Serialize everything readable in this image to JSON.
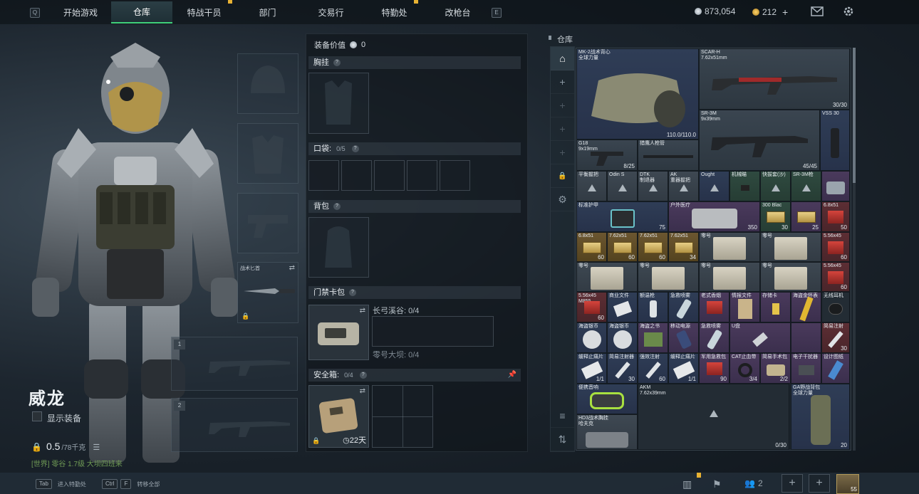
{
  "topbar": {
    "left_key": "Q",
    "right_key": "E",
    "tabs": [
      {
        "label": "开始游戏"
      },
      {
        "label": "仓库"
      },
      {
        "label": "特战干员"
      },
      {
        "label": "部门"
      },
      {
        "label": "交易行"
      },
      {
        "label": "特勤处"
      },
      {
        "label": "改枪台"
      }
    ],
    "silver": "873,054",
    "gold": "212",
    "add": "+",
    "mail_icon": "mail-icon",
    "settings_icon": "gear-icon"
  },
  "character": {
    "name": "威龙",
    "show_gear_label": "显示装备",
    "weight_value": "0.5",
    "weight_unit": "/78千克",
    "chat_line": "[世界] 零谷 1.7级 大坝四班来",
    "melee_label": "战术匕首"
  },
  "slots": {
    "primary_num": "1",
    "secondary_num": "2"
  },
  "gear": {
    "value_label": "装备价值",
    "value": "0",
    "chest_rig": "胸挂",
    "pockets": "口袋:",
    "pockets_count": "0/5",
    "backpack": "背包",
    "keycard": "门禁卡包",
    "key_lines": [
      "长弓溪谷: 0/4",
      "零号大坝: 0/4"
    ],
    "safebox": "安全箱:",
    "safebox_count": "0/4",
    "safebox_days": "22天"
  },
  "warehouse": {
    "title": "仓库",
    "items": [
      {
        "label": "MK-2战术背心\n全球力量",
        "count": "110.0/110.0"
      },
      {
        "label": "SCAR-H\n7.62x51mm",
        "count": "30/30"
      },
      {
        "label": "SR-3M\n9x39mm",
        "count": "45/45"
      },
      {
        "label": "VSS 30",
        "count": ""
      },
      {
        "label": "G18\n9x19mm",
        "count": "8/25"
      },
      {
        "label": "猎鹰人枪管",
        "count": ""
      },
      {
        "label": "平衡握把",
        "count": ""
      },
      {
        "label": "Odin S",
        "count": ""
      },
      {
        "label": "DTK\n制退器",
        "count": ""
      },
      {
        "label": "AK\n重器握把",
        "count": ""
      },
      {
        "label": "Ought",
        "count": ""
      },
      {
        "label": "机械瞄",
        "count": ""
      },
      {
        "label": "快拔套(沙)",
        "count": ""
      },
      {
        "label": "SR-3M枪",
        "count": ""
      },
      {
        "label": "标准护甲",
        "count": "75"
      },
      {
        "label": "户外医疗",
        "count": "350"
      },
      {
        "label": "300 Blac",
        "count": "30"
      },
      {
        "label": "",
        "count": "25"
      },
      {
        "label": "6.8x51",
        "count": "50"
      },
      {
        "label": "6.8x51",
        "count": "60"
      },
      {
        "label": "7.62x51",
        "count": "60"
      },
      {
        "label": "7.62x51",
        "count": "60"
      },
      {
        "label": "7.62x51",
        "count": "34"
      },
      {
        "label": "零号",
        "count": ""
      },
      {
        "label": "零号",
        "count": ""
      },
      {
        "label": "5.56x45",
        "count": "60"
      },
      {
        "label": "零号",
        "count": ""
      },
      {
        "label": "零号",
        "count": ""
      },
      {
        "label": "零号",
        "count": ""
      },
      {
        "label": "零号",
        "count": ""
      },
      {
        "label": "5.56x45",
        "count": "60"
      },
      {
        "label": "5.56x45\nM855",
        "count": "60"
      },
      {
        "label": "商业文件",
        "count": ""
      },
      {
        "label": "额温枪",
        "count": ""
      },
      {
        "label": "急救喷雾",
        "count": ""
      },
      {
        "label": "老式香烟",
        "count": ""
      },
      {
        "label": "情报文件",
        "count": ""
      },
      {
        "label": "存储卡",
        "count": ""
      },
      {
        "label": "海盗金怀表",
        "count": ""
      },
      {
        "label": "无线耳机",
        "count": ""
      },
      {
        "label": "海盗银币",
        "count": ""
      },
      {
        "label": "海盗银币",
        "count": ""
      },
      {
        "label": "海盗之书",
        "count": ""
      },
      {
        "label": "移动电源",
        "count": ""
      },
      {
        "label": "急救喷雾",
        "count": ""
      },
      {
        "label": "U盘",
        "count": ""
      },
      {
        "label": "",
        "count": ""
      },
      {
        "label": "简易注射",
        "count": "30"
      },
      {
        "label": "缓释止痛片",
        "count": "1/1"
      },
      {
        "label": "简易注射器",
        "count": "30"
      },
      {
        "label": "强效注射",
        "count": "60"
      },
      {
        "label": "缓释止痛片",
        "count": "1/1"
      },
      {
        "label": "军用急救包",
        "count": "90"
      },
      {
        "label": "CAT止血带",
        "count": "3/4"
      },
      {
        "label": "简易手术包",
        "count": "2/2"
      },
      {
        "label": "电子干扰器",
        "count": ""
      },
      {
        "label": "设计图纸",
        "count": ""
      },
      {
        "label": "便携音响",
        "count": ""
      },
      {
        "label": "AKM\n7.62x39mm",
        "count": "0/30"
      },
      {
        "label": "GA野战背包\n全球力量",
        "count": "20"
      },
      {
        "label": "HD3战术胸挂\n哈夫克",
        "count": ""
      }
    ]
  },
  "bottombar": {
    "tab_key": "Tab",
    "tab_hint": "进入特勤处",
    "ctrl_key": "Ctrl",
    "f_key": "F",
    "ctrl_hint": "转移全部",
    "squad_count": "2",
    "avatar_level": "55"
  }
}
